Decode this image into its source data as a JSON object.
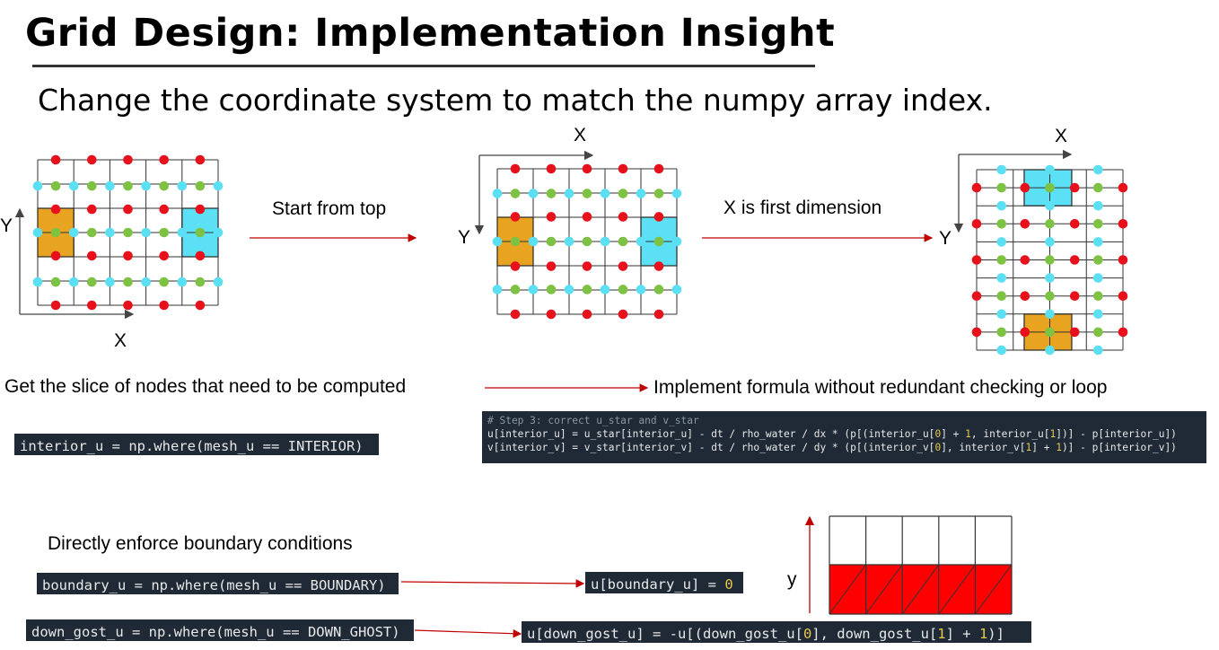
{
  "title": "Grid Design: Implementation Insight",
  "subtitle": "Change the coordinate system to match the numpy array index.",
  "diagram": {
    "left_axes": {
      "y": "Y",
      "x": "X"
    },
    "arrow1_label": "Start from top",
    "middle_axes": {
      "x": "X",
      "y": "Y"
    },
    "arrow2_label": "X is first dimension",
    "right_axes": {
      "x": "X",
      "y": "Y"
    },
    "ghost_axis_label": "y"
  },
  "steps": {
    "slice_label": "Get the slice of nodes that need to be computed",
    "formula_label": "Implement formula without redundant checking or loop",
    "boundary_label": "Directly enforce boundary conditions"
  },
  "code": {
    "interior": "interior_u = np.where(mesh_u == INTERIOR)",
    "correction_comment": "# Step 3: correct u_star and v_star",
    "correction_u_a": "u[interior_u] = u_star[interior_u] - dt / rho_water / dx * (p[(interior_u[",
    "correction_u_n1": "0",
    "correction_u_b": "] + ",
    "correction_u_n2": "1",
    "correction_u_c": ", interior_u[",
    "correction_u_n3": "1",
    "correction_u_d": "])] - p[interior_u])",
    "correction_v_a": "v[interior_v] = v_star[interior_v] - dt / rho_water / dy * (p[(interior_v[",
    "correction_v_n1": "0",
    "correction_v_b": "], interior_v[",
    "correction_v_n2": "1",
    "correction_v_c": "] + ",
    "correction_v_n3": "1",
    "correction_v_d": ")] - p[interior_v])",
    "boundary": "boundary_u = np.where(mesh_u == BOUNDARY)",
    "boundary_assign_a": "u[boundary_u] = ",
    "boundary_assign_n": "0",
    "down_ghost": "down_gost_u = np.where(mesh_u == DOWN_GHOST)",
    "ghost_assign_a": "u[down_gost_u] = -u[(down_gost_u[",
    "ghost_assign_n1": "0",
    "ghost_assign_b": "], down_gost_u[",
    "ghost_assign_n2": "1",
    "ghost_assign_c": "] + ",
    "ghost_assign_n3": "1",
    "ghost_assign_d": ")]"
  },
  "colors": {
    "red_node": "#e8101a",
    "green_node": "#7dc242",
    "cyan_node": "#5bdff2",
    "orange_cell": "#e8a320",
    "cyan_cell": "#5ce0f5",
    "arrow": "#c00000",
    "code_bg": "#1f2a36",
    "ghost_fill": "#ff0000"
  }
}
